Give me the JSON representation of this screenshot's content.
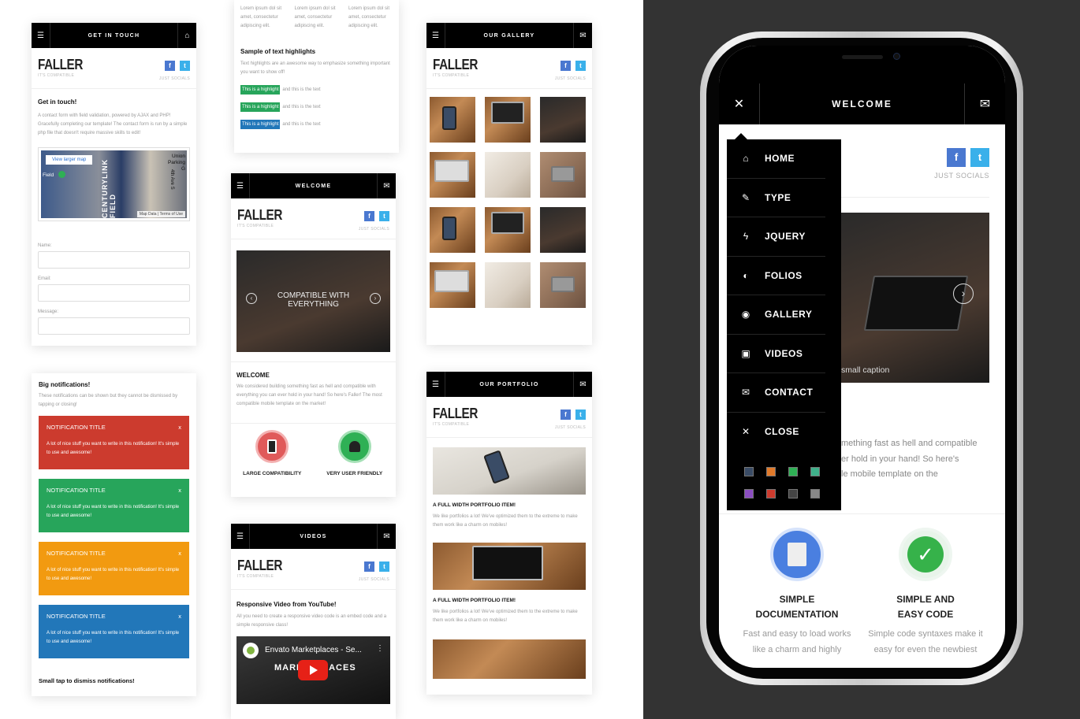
{
  "colors": {
    "red": "#cc3b2e",
    "green": "#27a55b",
    "orange": "#f29a10",
    "blue": "#2277b9",
    "highlight_green": "#27a55b",
    "highlight_blue": "#2277b9",
    "facebook": "#4a78d0",
    "twitter": "#3ab0ea",
    "dark_bg": "#333333"
  },
  "brand": {
    "logo": "FALLER",
    "tagline": "IT'S COMPATIBLE",
    "socials_label": "JUST SOCIALS",
    "fb": "f",
    "tw": "t"
  },
  "contact_card": {
    "header": "GET IN TOUCH",
    "heading": "Get in touch!",
    "text": "A contact form with field validation, powered by AJAX and PHP! Gracefully completing our template! The contact form is run by a simple php file that doesn't require massive skills to edit!",
    "map_button": "View larger map",
    "map_label_stadium": "CENTURYLINK FIELD",
    "map_label_parking": "Union Parking G",
    "map_label_street": "4th Ave S",
    "map_label_field": "Field",
    "map_footer_data": "Map Data",
    "map_footer_terms": "Terms of Use",
    "name_label": "Name:",
    "email_label": "Email:",
    "message_label": "Message:"
  },
  "highlights_card": {
    "lorem": "Lorem ipsum dol sit amet, consectetur adipiscing elit.",
    "heading": "Sample of text highlights",
    "text": "Text highlights are an awesome way to emphasize something important you want to show off!",
    "highlight": "This is a highlight",
    "after": "and this is the text"
  },
  "gallery_card": {
    "header": "OUR GALLERY"
  },
  "notifications_card": {
    "heading": "Big notifications!",
    "text": "These notifications can be shown but they cannot be dismissed by tapping or closing!",
    "title": "NOTIFICATION TITLE",
    "close": "x",
    "message": "A lot of nice stuff you want to write in this notification! It's simple to use and awesome!",
    "footer": "Small tap to dismiss notifications!"
  },
  "welcome_card": {
    "header": "WELCOME",
    "slider_caption": "COMPATIBLE WITH EVERYTHING",
    "heading": "WELCOME",
    "text": "We considered building something fast as hell and compatible with everything you can ever hold in your hand! So here's Faller! The most compatible mobile template on the market!",
    "feature1": "LARGE COMPATIBILITY",
    "feature2": "VERY USER FRIENDLY"
  },
  "videos_card": {
    "header": "VIDEOS",
    "heading": "Responsive Video from YouTube!",
    "text": "All you need to create a responsive video code is an embed code and a simple responsive class!",
    "video_title": "Envato Marketplaces - Se...",
    "video_brand": "MARKETPLACES"
  },
  "portfolio_card": {
    "header": "OUR PORTFOLIO",
    "item_title": "A FULL WIDTH PORTFOLIO ITEM!",
    "item_text": "We like portfolios a lot! We've optimized them to the extreme to make them work like a charm on mobiles!"
  },
  "phone": {
    "header": "WELCOME",
    "socials_label": "JUST SOCIALS",
    "caption": "small caption",
    "body_line1": "mething fast as hell and compatible",
    "body_line2": "er hold in your hand! So here's",
    "body_line3": "le mobile template on the",
    "menu": [
      {
        "icon": "⌂",
        "label": "HOME"
      },
      {
        "icon": "✎",
        "label": "TYPE"
      },
      {
        "icon": "ϟ",
        "label": "JQUERY"
      },
      {
        "icon": "◐",
        "label": "FOLIOS"
      },
      {
        "icon": "◉",
        "label": "GALLERY"
      },
      {
        "icon": "▣",
        "label": "VIDEOS"
      },
      {
        "icon": "✉",
        "label": "CONTACT"
      },
      {
        "icon": "✕",
        "label": "CLOSE"
      }
    ],
    "swatches": [
      "#3a4c66",
      "#e0792a",
      "#2fb055",
      "#3fb08a",
      "#8b4ec0",
      "#cc3b2e",
      "#444444",
      "#888888"
    ],
    "feature1_line1": "SIMPLE",
    "feature1_line2": "DOCUMENTATION",
    "feature2_line1": "SIMPLE AND",
    "feature2_line2": "EASY CODE",
    "feature1_text": "Fast and easy to load works like a charm and highly compatible with multiple",
    "feature2_text": "Simple code syntaxes make it easy for even the newbiest users to understand and use"
  }
}
